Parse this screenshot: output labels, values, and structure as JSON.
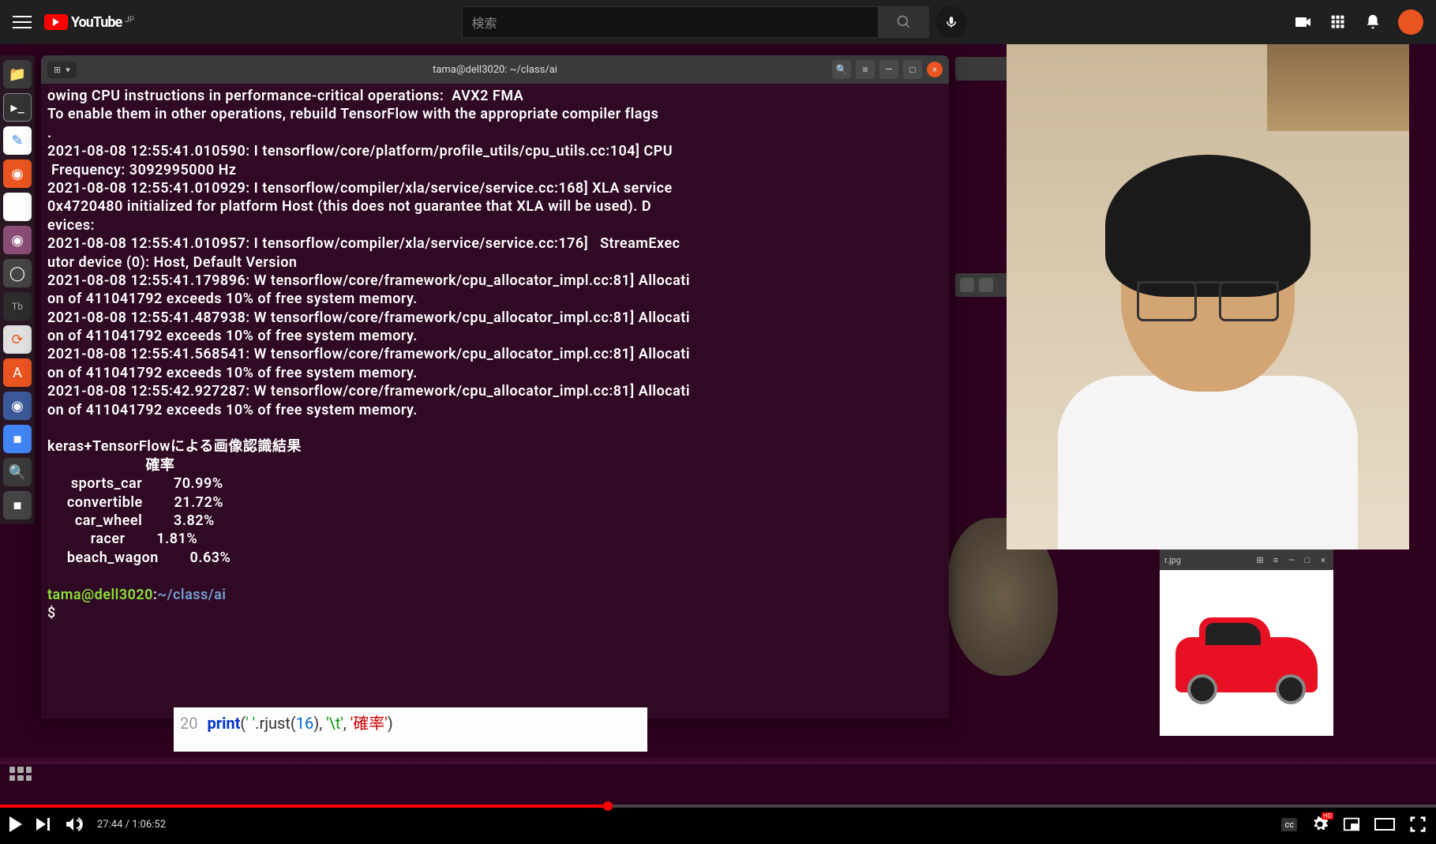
{
  "header": {
    "logo_text": "YouTube",
    "region": "JP",
    "search_placeholder": "検索"
  },
  "terminal": {
    "title": "tama@dell3020: ~/class/ai",
    "lines": [
      "owing CPU instructions in performance-critical operations:  AVX2 FMA",
      "To enable them in other operations, rebuild TensorFlow with the appropriate compiler flags",
      ".",
      "2021-08-08 12:55:41.010590: I tensorflow/core/platform/profile_utils/cpu_utils.cc:104] CPU",
      " Frequency: 3092995000 Hz",
      "2021-08-08 12:55:41.010929: I tensorflow/compiler/xla/service/service.cc:168] XLA service ",
      "0x4720480 initialized for platform Host (this does not guarantee that XLA will be used). D",
      "evices:",
      "2021-08-08 12:55:41.010957: I tensorflow/compiler/xla/service/service.cc:176]   StreamExec",
      "utor device (0): Host, Default Version",
      "2021-08-08 12:55:41.179896: W tensorflow/core/framework/cpu_allocator_impl.cc:81] Allocati",
      "on of 411041792 exceeds 10% of free system memory.",
      "2021-08-08 12:55:41.487938: W tensorflow/core/framework/cpu_allocator_impl.cc:81] Allocati",
      "on of 411041792 exceeds 10% of free system memory.",
      "2021-08-08 12:55:41.568541: W tensorflow/core/framework/cpu_allocator_impl.cc:81] Allocati",
      "on of 411041792 exceeds 10% of free system memory.",
      "2021-08-08 12:55:42.927287: W tensorflow/core/framework/cpu_allocator_impl.cc:81] Allocati",
      "on of 411041792 exceeds 10% of free system memory.",
      "",
      "keras+TensorFlowによる画像認識結果",
      "                         確率",
      "      sports_car        70.99%",
      "     convertible        21.72%",
      "       car_wheel        3.82%",
      "           racer        1.81%",
      "     beach_wagon        0.63%",
      ""
    ],
    "prompt_user": "tama@dell3020",
    "prompt_sep": ":",
    "prompt_path": "~/class/ai",
    "prompt_sym": "$ "
  },
  "editor": {
    "line_no": "20",
    "kw": "print",
    "open": "(",
    "str1": "'   '",
    "method": ".rjust(",
    "num": "16",
    "mid": "), ",
    "str2": "'\\t'",
    "comma": ", ",
    "str3": "'確率'",
    "close": ")"
  },
  "car_window": {
    "title": "r.jpg"
  },
  "player": {
    "current": "27:44",
    "sep": " / ",
    "total": "1:06:52",
    "cc": "cc",
    "hd": "HD"
  }
}
